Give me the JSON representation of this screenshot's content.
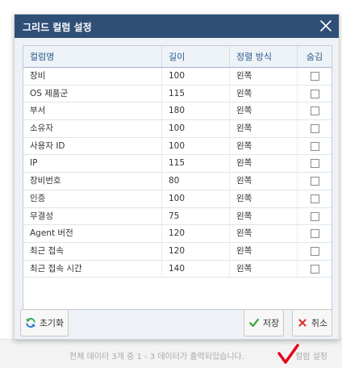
{
  "dialog": {
    "title": "그리드 컬럼 설정",
    "columns": [
      "컬럼명",
      "길이",
      "정렬 방식",
      "숨김"
    ],
    "rows": [
      {
        "name": "장비",
        "width": "100",
        "align": "왼쪽",
        "hidden": false
      },
      {
        "name": "OS 제품군",
        "width": "115",
        "align": "왼쪽",
        "hidden": false
      },
      {
        "name": "부서",
        "width": "180",
        "align": "왼쪽",
        "hidden": false
      },
      {
        "name": "소유자",
        "width": "100",
        "align": "왼쪽",
        "hidden": false
      },
      {
        "name": "사용자 ID",
        "width": "100",
        "align": "왼쪽",
        "hidden": false
      },
      {
        "name": "IP",
        "width": "115",
        "align": "왼쪽",
        "hidden": false
      },
      {
        "name": "장비번호",
        "width": "80",
        "align": "왼쪽",
        "hidden": false
      },
      {
        "name": "인증",
        "width": "100",
        "align": "왼쪽",
        "hidden": false
      },
      {
        "name": "무결성",
        "width": "75",
        "align": "왼쪽",
        "hidden": false
      },
      {
        "name": "Agent 버전",
        "width": "120",
        "align": "왼쪽",
        "hidden": false
      },
      {
        "name": "최근 접속",
        "width": "120",
        "align": "왼쪽",
        "hidden": false
      },
      {
        "name": "최근 접속 시간",
        "width": "140",
        "align": "왼쪽",
        "hidden": false
      }
    ],
    "buttons": {
      "reset": "초기화",
      "save": "저장",
      "cancel": "취소"
    }
  },
  "footer": {
    "status": "전체 데이터 3개 중 1 - 3 데이터가 출력되었습니다.",
    "link": "컬럼 설정"
  },
  "colors": {
    "header_bg": "#2f4f77",
    "accent_blue": "#2b5a8c",
    "save_green": "#3aa53a",
    "cancel_red": "#d9302c",
    "reset_green": "#2fa84f",
    "reset_blue": "#2b7bd1",
    "annotation_red": "#e3001b"
  },
  "icons": {
    "close": "close-icon",
    "reset": "refresh-icon",
    "save": "check-icon",
    "cancel": "x-icon"
  }
}
